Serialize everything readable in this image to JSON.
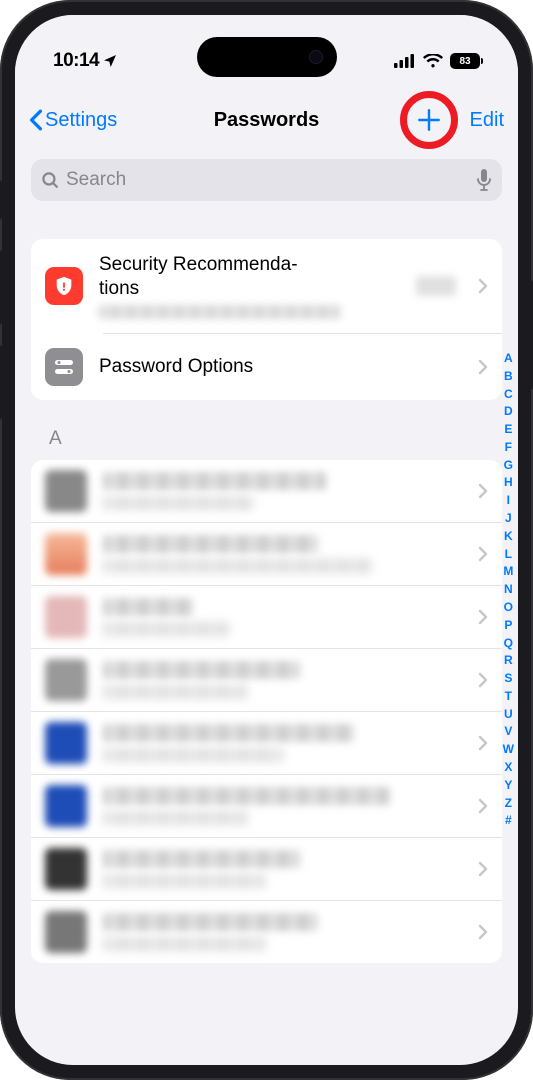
{
  "status": {
    "time": "10:14",
    "battery": "83"
  },
  "nav": {
    "back_label": "Settings",
    "title": "Passwords",
    "edit_label": "Edit"
  },
  "search": {
    "placeholder": "Search"
  },
  "card": {
    "security_label": "Security Recommenda-\ntions",
    "options_label": "Password Options"
  },
  "section": {
    "header_a": "A"
  },
  "alpha_index": [
    "A",
    "B",
    "C",
    "D",
    "E",
    "F",
    "G",
    "H",
    "I",
    "J",
    "K",
    "L",
    "M",
    "N",
    "O",
    "P",
    "Q",
    "R",
    "S",
    "T",
    "U",
    "V",
    "W",
    "X",
    "Y",
    "Z",
    "#"
  ],
  "list_items": [
    {
      "icon_bg": "#888888",
      "title_w": "62%",
      "sub_w": "42%"
    },
    {
      "icon_bg": "linear-gradient(#f5b99a,#e67e5b)",
      "title_w": "60%",
      "sub_w": "75%"
    },
    {
      "icon_bg": "#e4b8b8",
      "title_w": "25%",
      "sub_w": "35%"
    },
    {
      "icon_bg": "#999999",
      "title_w": "55%",
      "sub_w": "40%"
    },
    {
      "icon_bg": "#1e4db7",
      "title_w": "70%",
      "sub_w": "50%"
    },
    {
      "icon_bg": "#1e4db7",
      "title_w": "80%",
      "sub_w": "40%"
    },
    {
      "icon_bg": "#333333",
      "title_w": "55%",
      "sub_w": "45%"
    },
    {
      "icon_bg": "#777777",
      "title_w": "60%",
      "sub_w": "45%"
    }
  ]
}
